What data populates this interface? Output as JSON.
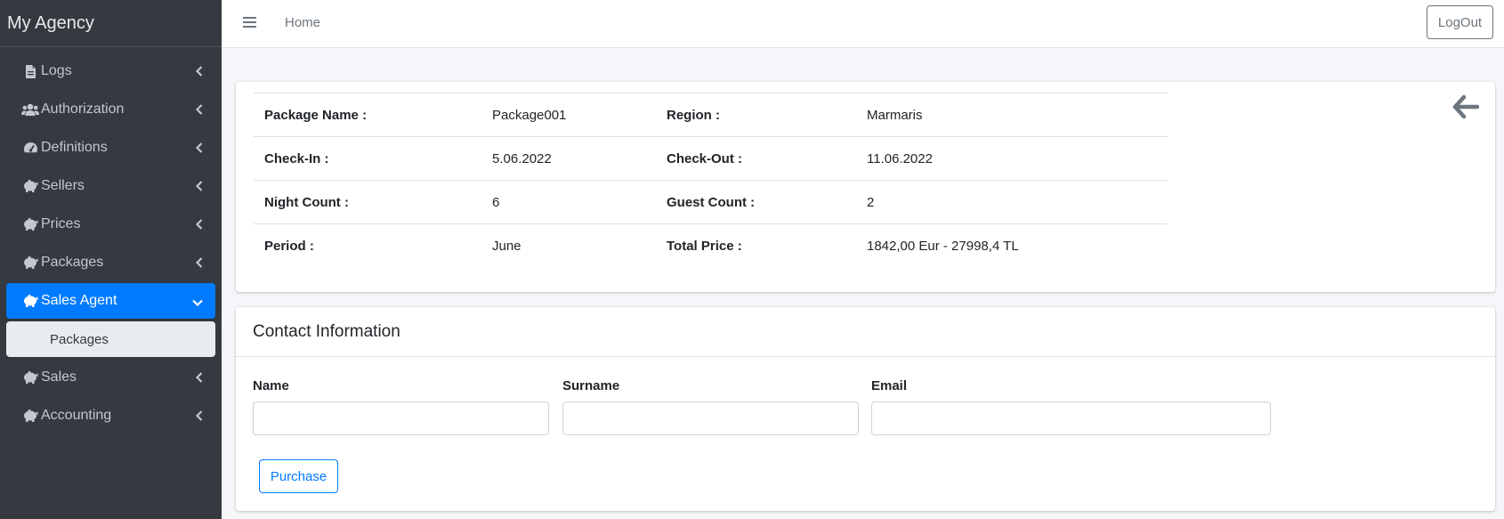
{
  "brand": "My Agency",
  "sidebar": {
    "items": [
      {
        "label": "Logs",
        "icon": "file-icon"
      },
      {
        "label": "Authorization",
        "icon": "users-icon"
      },
      {
        "label": "Definitions",
        "icon": "gauge-icon"
      },
      {
        "label": "Sellers",
        "icon": "piggy-bank-icon"
      },
      {
        "label": "Prices",
        "icon": "piggy-bank-icon"
      },
      {
        "label": "Packages",
        "icon": "piggy-bank-icon"
      },
      {
        "label": "Sales Agent",
        "icon": "piggy-bank-icon",
        "active": true
      },
      {
        "label": "Sales",
        "icon": "piggy-bank-icon"
      },
      {
        "label": "Accounting",
        "icon": "piggy-bank-icon"
      }
    ],
    "sub_item": "Packages"
  },
  "topbar": {
    "home": "Home",
    "logout": "LogOut"
  },
  "package": {
    "rows": [
      {
        "l1": "Package Name :",
        "v1": "Package001",
        "l2": "Region :",
        "v2": "Marmaris"
      },
      {
        "l1": "Check-In :",
        "v1": "5.06.2022",
        "l2": "Check-Out :",
        "v2": "11.06.2022"
      },
      {
        "l1": "Night Count :",
        "v1": "6",
        "l2": "Guest Count :",
        "v2": "2"
      },
      {
        "l1": "Period :",
        "v1": "June",
        "l2": "Total Price :",
        "v2": "1842,00 Eur - 27998,4 TL"
      }
    ]
  },
  "contact": {
    "title": "Contact Information",
    "name_label": "Name",
    "surname_label": "Surname",
    "email_label": "Email",
    "name_value": "",
    "surname_value": "",
    "email_value": "",
    "purchase": "Purchase"
  },
  "colors": {
    "sidebar_bg": "#343a40",
    "active": "#007bff"
  }
}
